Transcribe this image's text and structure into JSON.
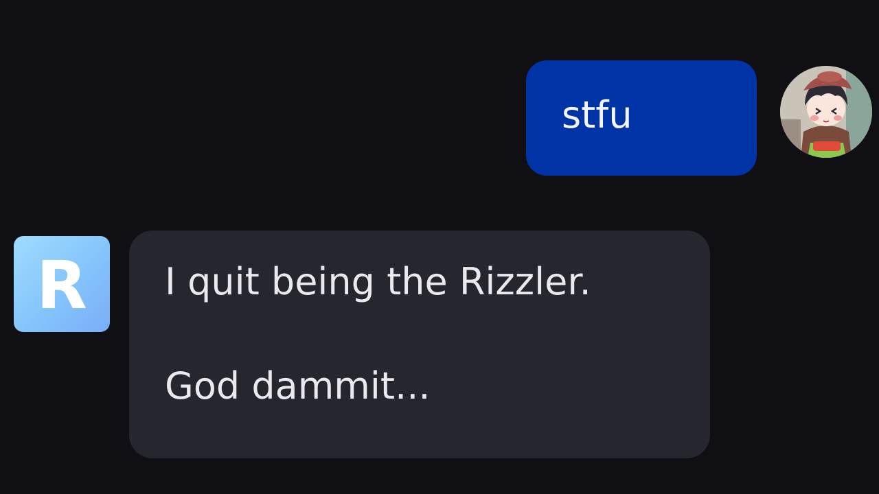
{
  "conversation": {
    "messages": [
      {
        "sender": "user",
        "avatar_icon": "anime-character-avatar-icon",
        "lines": [
          "stfu"
        ]
      },
      {
        "sender": "bot",
        "avatar_letter": "R",
        "lines": [
          "I quit being the Rizzler.",
          "God dammit..."
        ]
      }
    ]
  },
  "colors": {
    "background": "#0f0f14",
    "user_bubble": "#0033a6",
    "bot_bubble": "#26262e",
    "bot_avatar": "#84c4fb"
  }
}
